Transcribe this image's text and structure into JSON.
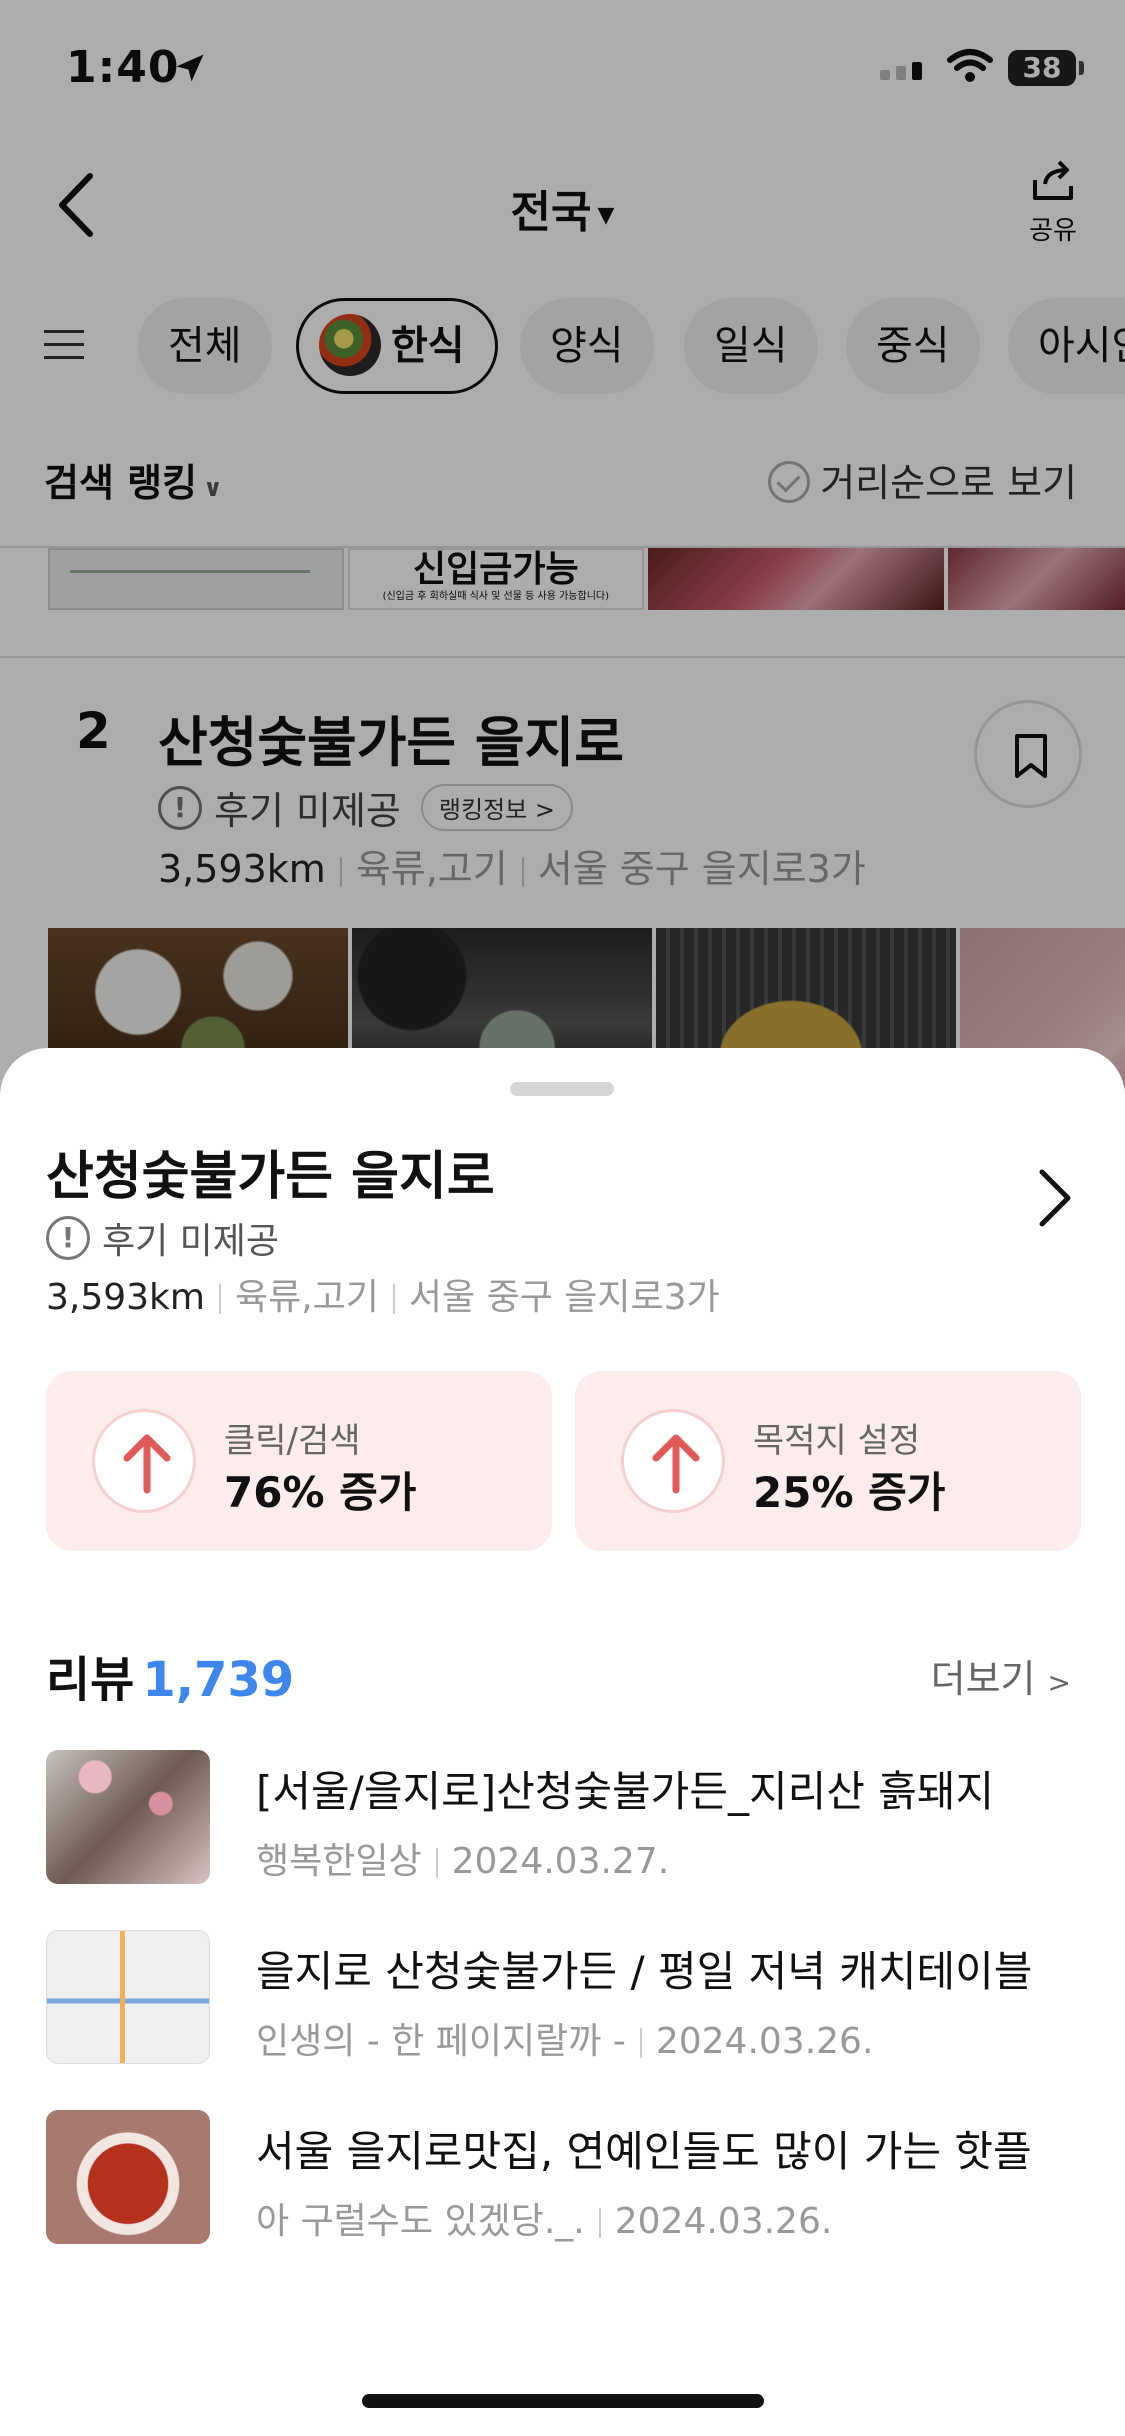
{
  "status": {
    "time": "1:40",
    "battery": "38"
  },
  "nav": {
    "region": "전국",
    "share_label": "공유"
  },
  "categories": [
    {
      "label": "전체"
    },
    {
      "label": "한식"
    },
    {
      "label": "양식"
    },
    {
      "label": "일식"
    },
    {
      "label": "중식"
    },
    {
      "label": "아시안"
    }
  ],
  "sort": {
    "label": "검색 랭킹",
    "distance_toggle": "거리순으로 보기"
  },
  "banner": {
    "title": "신입금가능",
    "note": "(신입금 후 회하실때 식사 및 선물 등 사용 가능합니다)"
  },
  "rank_card": {
    "rank": "2",
    "name": "산청숯불가든 을지로",
    "review_status": "후기 미제공",
    "ranking_badge": "랭킹정보 >",
    "distance": "3,593km",
    "category": "육류,고기",
    "address": "서울 중구 을지로3가"
  },
  "sheet": {
    "title": "산청숯불가든 을지로",
    "review_status": "후기 미제공",
    "distance": "3,593km",
    "category": "육류,고기",
    "address": "서울 중구 을지로3가",
    "stats": [
      {
        "label": "클릭/검색",
        "value": "76% 증가"
      },
      {
        "label": "목적지 설정",
        "value": "25% 증가"
      }
    ],
    "reviews_label": "리뷰",
    "reviews_count": "1,739",
    "more_label": "더보기",
    "reviews": [
      {
        "title": "[서울/을지로]산청숯불가든_지리산 흙돼지",
        "author": "행복한일상",
        "date": "2024.03.27."
      },
      {
        "title": "을지로 산청숯불가든 / 평일 저녁 캐치테이블",
        "author": "인생의 - 한 페이지랄까 -",
        "date": "2024.03.26."
      },
      {
        "title": "서울 을지로맛집, 연예인들도 많이 가는 핫플",
        "author": "아 구럴수도 있겠당._.",
        "date": "2024.03.26."
      }
    ]
  },
  "colors": {
    "accent_blue": "#3d86ec",
    "stat_bg": "#fdecec",
    "stat_arrow": "#e05a5a"
  },
  "icons": [
    "location-arrow-icon",
    "wifi-icon",
    "back-chevron-icon",
    "share-icon",
    "menu-icon",
    "check-icon",
    "bookmark-icon",
    "info-icon",
    "chevron-right-icon",
    "arrow-up-icon"
  ]
}
